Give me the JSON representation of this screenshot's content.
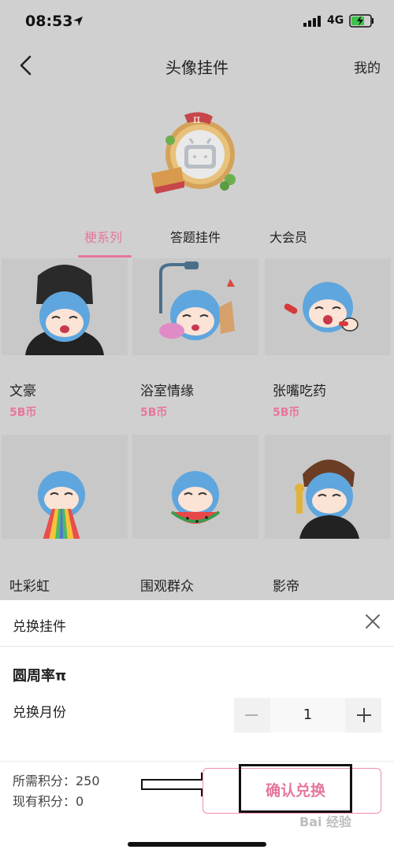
{
  "status_bar": {
    "time": "08:53",
    "network": "4G"
  },
  "nav": {
    "title": "头像挂件",
    "right_link": "我的"
  },
  "tabs": [
    {
      "label": "梗系列",
      "active": true
    },
    {
      "label": "答题挂件",
      "active": false
    },
    {
      "label": "大会员",
      "active": false
    }
  ],
  "items": [
    {
      "name": "文豪",
      "price": "5B币"
    },
    {
      "name": "浴室情缘",
      "price": "5B币"
    },
    {
      "name": "张嘴吃药",
      "price": "5B币"
    },
    {
      "name": "吐彩虹"
    },
    {
      "name": "围观群众"
    },
    {
      "name": "影帝"
    }
  ],
  "sheet": {
    "title": "兑换挂件",
    "pendant_name": "圆周率π",
    "months_label": "兑换月份",
    "quantity": "1",
    "required_points": "所需积分：250",
    "current_points": "现有积分：0",
    "confirm_label": "确认兑换"
  },
  "watermark": "Bai 经验",
  "colors": {
    "accent": "#e7769c",
    "overlay_gray": "#d0d0d0"
  }
}
